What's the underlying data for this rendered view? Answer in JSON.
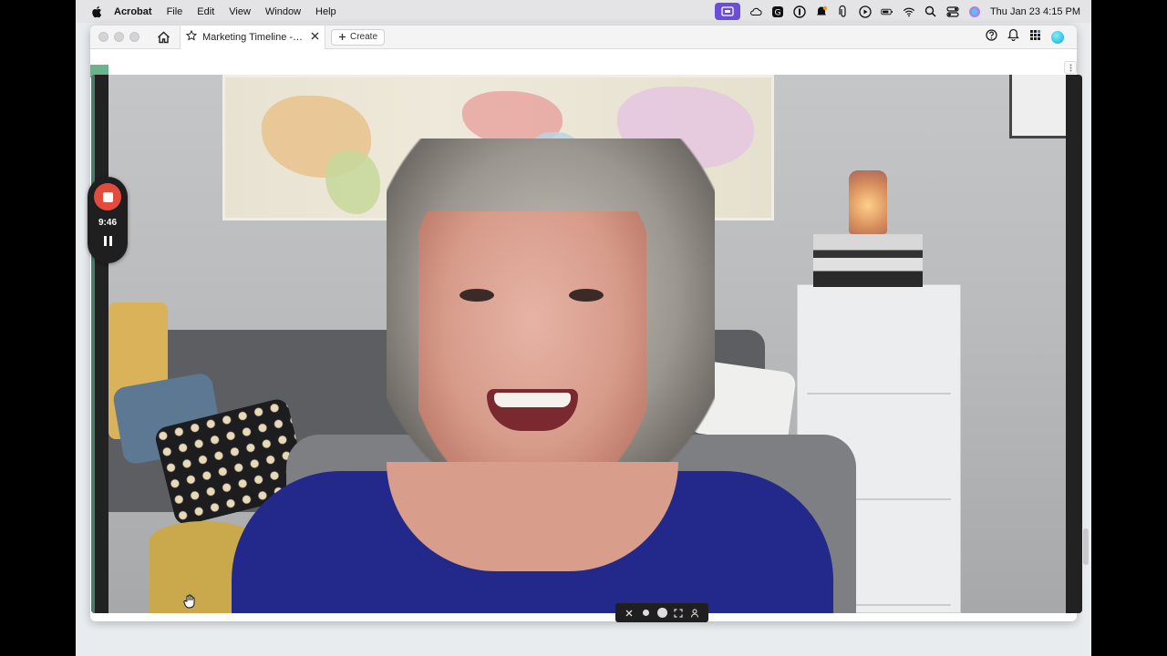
{
  "menubar": {
    "app_name": "Acrobat",
    "items": [
      "File",
      "Edit",
      "View",
      "Window",
      "Help"
    ],
    "clock": "Thu Jan 23  4:15 PM"
  },
  "window": {
    "tab_title": "Marketing Timeline - H...",
    "create_label": "Create"
  },
  "recorder": {
    "timer": "9:46"
  },
  "colors": {
    "record_red": "#e34b3c",
    "menubar_highlight": "#6a4dd8",
    "sweater_blue": "#23288b"
  }
}
